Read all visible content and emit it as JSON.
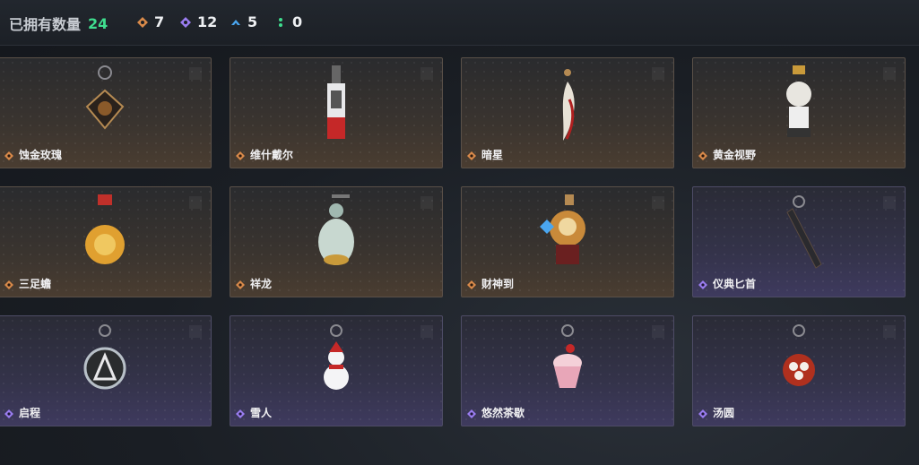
{
  "header": {
    "owned_label": "已拥有数量",
    "owned_count": "24",
    "stats": [
      {
        "icon": "orange-diamond-icon",
        "value": "7",
        "color": "#d98a4a"
      },
      {
        "icon": "purple-diamond-icon",
        "value": "12",
        "color": "#9a7df0"
      },
      {
        "icon": "blue-chevron-icon",
        "value": "5",
        "color": "#4aa6f0"
      },
      {
        "icon": "green-dots-icon",
        "value": "0",
        "color": "#3fdc8e"
      }
    ]
  },
  "items": [
    {
      "name": "蚀金玫瑰",
      "rarity": "orange"
    },
    {
      "name": "维什戴尔",
      "rarity": "orange"
    },
    {
      "name": "暗星",
      "rarity": "orange"
    },
    {
      "name": "黄金视野",
      "rarity": "orange"
    },
    {
      "name": "三足蟾",
      "rarity": "orange"
    },
    {
      "name": "祥龙",
      "rarity": "orange"
    },
    {
      "name": "财神到",
      "rarity": "orange"
    },
    {
      "name": "仪典匕首",
      "rarity": "purple"
    },
    {
      "name": "启程",
      "rarity": "purple"
    },
    {
      "name": "雪人",
      "rarity": "purple"
    },
    {
      "name": "悠然茶歇",
      "rarity": "purple"
    },
    {
      "name": "汤圆",
      "rarity": "purple"
    }
  ],
  "colors": {
    "orange_rarity": "#d98a4a",
    "purple_rarity": "#9a7df0",
    "owned_count": "#3fdc8e"
  }
}
